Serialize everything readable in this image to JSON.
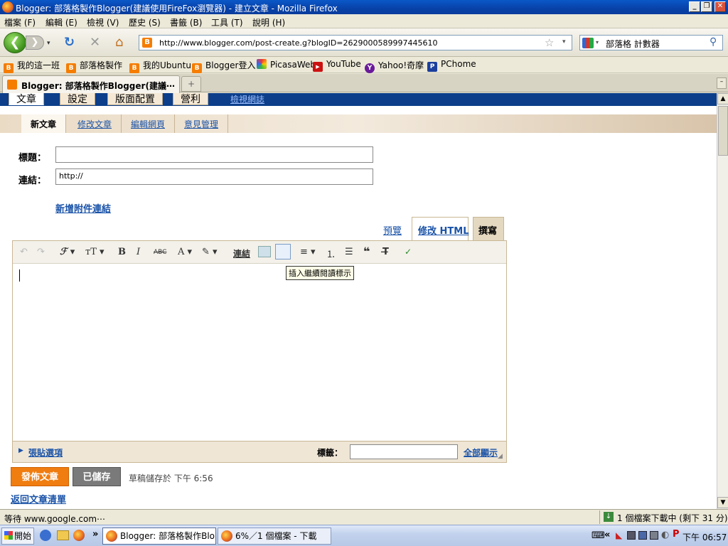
{
  "window": {
    "title": "Blogger: 部落格製作Blogger(建議使用FireFox瀏覽器) - 建立文章 - Mozilla Firefox",
    "min": "_",
    "max": "❐",
    "close": "✕"
  },
  "menu": [
    "檔案 (F)",
    "編輯 (E)",
    "檢視 (V)",
    "歷史 (S)",
    "書籤 (B)",
    "工具 (T)",
    "說明 (H)"
  ],
  "nav": {
    "url": "http://www.blogger.com/post-create.g?blogID=2629000589997445610",
    "search_value": "部落格 計數器"
  },
  "bookmarks": [
    {
      "label": "我的這一班",
      "icon": "blogger-icon"
    },
    {
      "label": "部落格製作",
      "icon": "blogger-icon"
    },
    {
      "label": "我的Ubuntu",
      "icon": "blogger-icon"
    },
    {
      "label": "Blogger登入",
      "icon": "blogger-icon"
    },
    {
      "label": "PicasaWeb",
      "icon": "picasa-icon"
    },
    {
      "label": "YouTube",
      "icon": "youtube-icon"
    },
    {
      "label": "Yahoo!奇摩",
      "icon": "yahoo-icon"
    },
    {
      "label": "PChome",
      "icon": "pchome-icon"
    }
  ],
  "tab": {
    "title": "Blogger: 部落格製作Blogger(建議⋯",
    "new_tab": "+"
  },
  "blogger": {
    "top_tabs": [
      "文章",
      "設定",
      "版面配置",
      "營利",
      "檢視網誌"
    ],
    "sub_tabs": [
      "新文章",
      "修改文章",
      "編輯網頁",
      "意見管理"
    ],
    "title_label": "標題：",
    "link_label": "連結：",
    "link_value": "http://",
    "title_value": "",
    "add_enclosure": "新增附件連結",
    "mode_preview": "預覽",
    "mode_html": "修改 HTML",
    "mode_compose": "撰寫",
    "link_tool": "連結",
    "tooltip": "插入繼續閱讀標示",
    "post_options": "張貼選項",
    "labels_label": "標籤：",
    "show_all": "全部顯示",
    "publish": "發佈文章",
    "saved": "已儲存",
    "draft_status": "草稿儲存於 下午 6:56",
    "back_to_list": "返回文章清單"
  },
  "status": {
    "left": "等待 www.google.com⋯",
    "right": "1 個檔案下載中 (剩下 31 分)"
  },
  "taskbar": {
    "start": "開始",
    "overflow": "»",
    "tasks": [
      "Blogger: 部落格製作Blo...",
      "6%／1 個檔案 - 下載"
    ],
    "tray_overflow": "«",
    "clock": "下午 06:57"
  }
}
